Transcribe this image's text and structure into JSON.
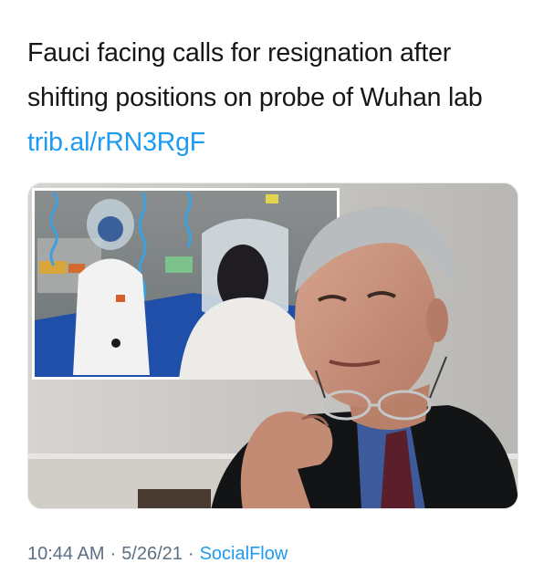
{
  "tweet": {
    "text_before_link": "Fauci facing calls for resignation after shifting positions on probe of Wuhan lab ",
    "link_text": "trib.al/rRN3RgF"
  },
  "media": {
    "icon": "photo-composite-icon"
  },
  "meta": {
    "time": "10:44 AM",
    "separator": "·",
    "date": "5/26/21",
    "source": "SocialFlow"
  },
  "colors": {
    "text": "#14171a",
    "link": "#1d9bf0",
    "muted": "#5b7083"
  }
}
